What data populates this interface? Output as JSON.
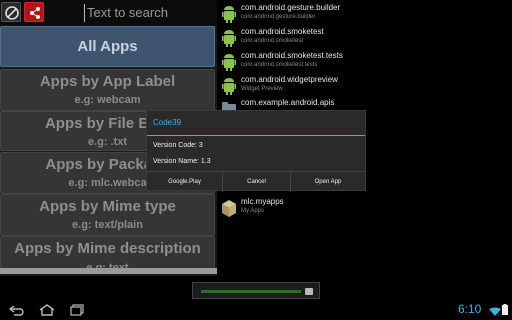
{
  "search": {
    "placeholder": "Text to search"
  },
  "categories": [
    {
      "title": "All Apps"
    },
    {
      "title": "Apps by App Label",
      "example": "e.g: webcam"
    },
    {
      "title": "Apps by File Exte",
      "example": "e.g: .txt"
    },
    {
      "title": "Apps by Package",
      "example": "e.g: mlc.webca"
    },
    {
      "title": "Apps by Mime type",
      "example": "e.g: text/plain"
    },
    {
      "title": "Apps by Mime description",
      "example": "e.g: text"
    }
  ],
  "apps": [
    {
      "name": "com.android.gesture.builder",
      "label": "com.android.gesture.builder"
    },
    {
      "name": "com.android.smoketest",
      "label": "com.android.smoketest"
    },
    {
      "name": "com.android.smoketest.tests",
      "label": "com.android.smoketest.tests"
    },
    {
      "name": "com.android.widgetpreview",
      "label": "Widget Preview"
    },
    {
      "name": "com.example.android.apis",
      "label": ""
    },
    {
      "name": "mlc.myapps",
      "label": "My Apps"
    }
  ],
  "dialog": {
    "title": "Code39",
    "version_code": "Version Code: 3",
    "version_name": "Version Name: 1.3",
    "buttons": {
      "google_play": "Google.Play",
      "cancel": "Cancel",
      "open_app": "Open App"
    }
  },
  "status": {
    "time": "6:10"
  },
  "colors": {
    "accent": "#33b5e5",
    "selected": "#3f546f",
    "share_button": "#b3151b"
  },
  "icons": {
    "clear": "clear-search-icon",
    "share": "share-icon",
    "android": "android-robot-icon",
    "back": "back-icon",
    "home": "home-icon",
    "recents": "recent-apps-icon"
  }
}
